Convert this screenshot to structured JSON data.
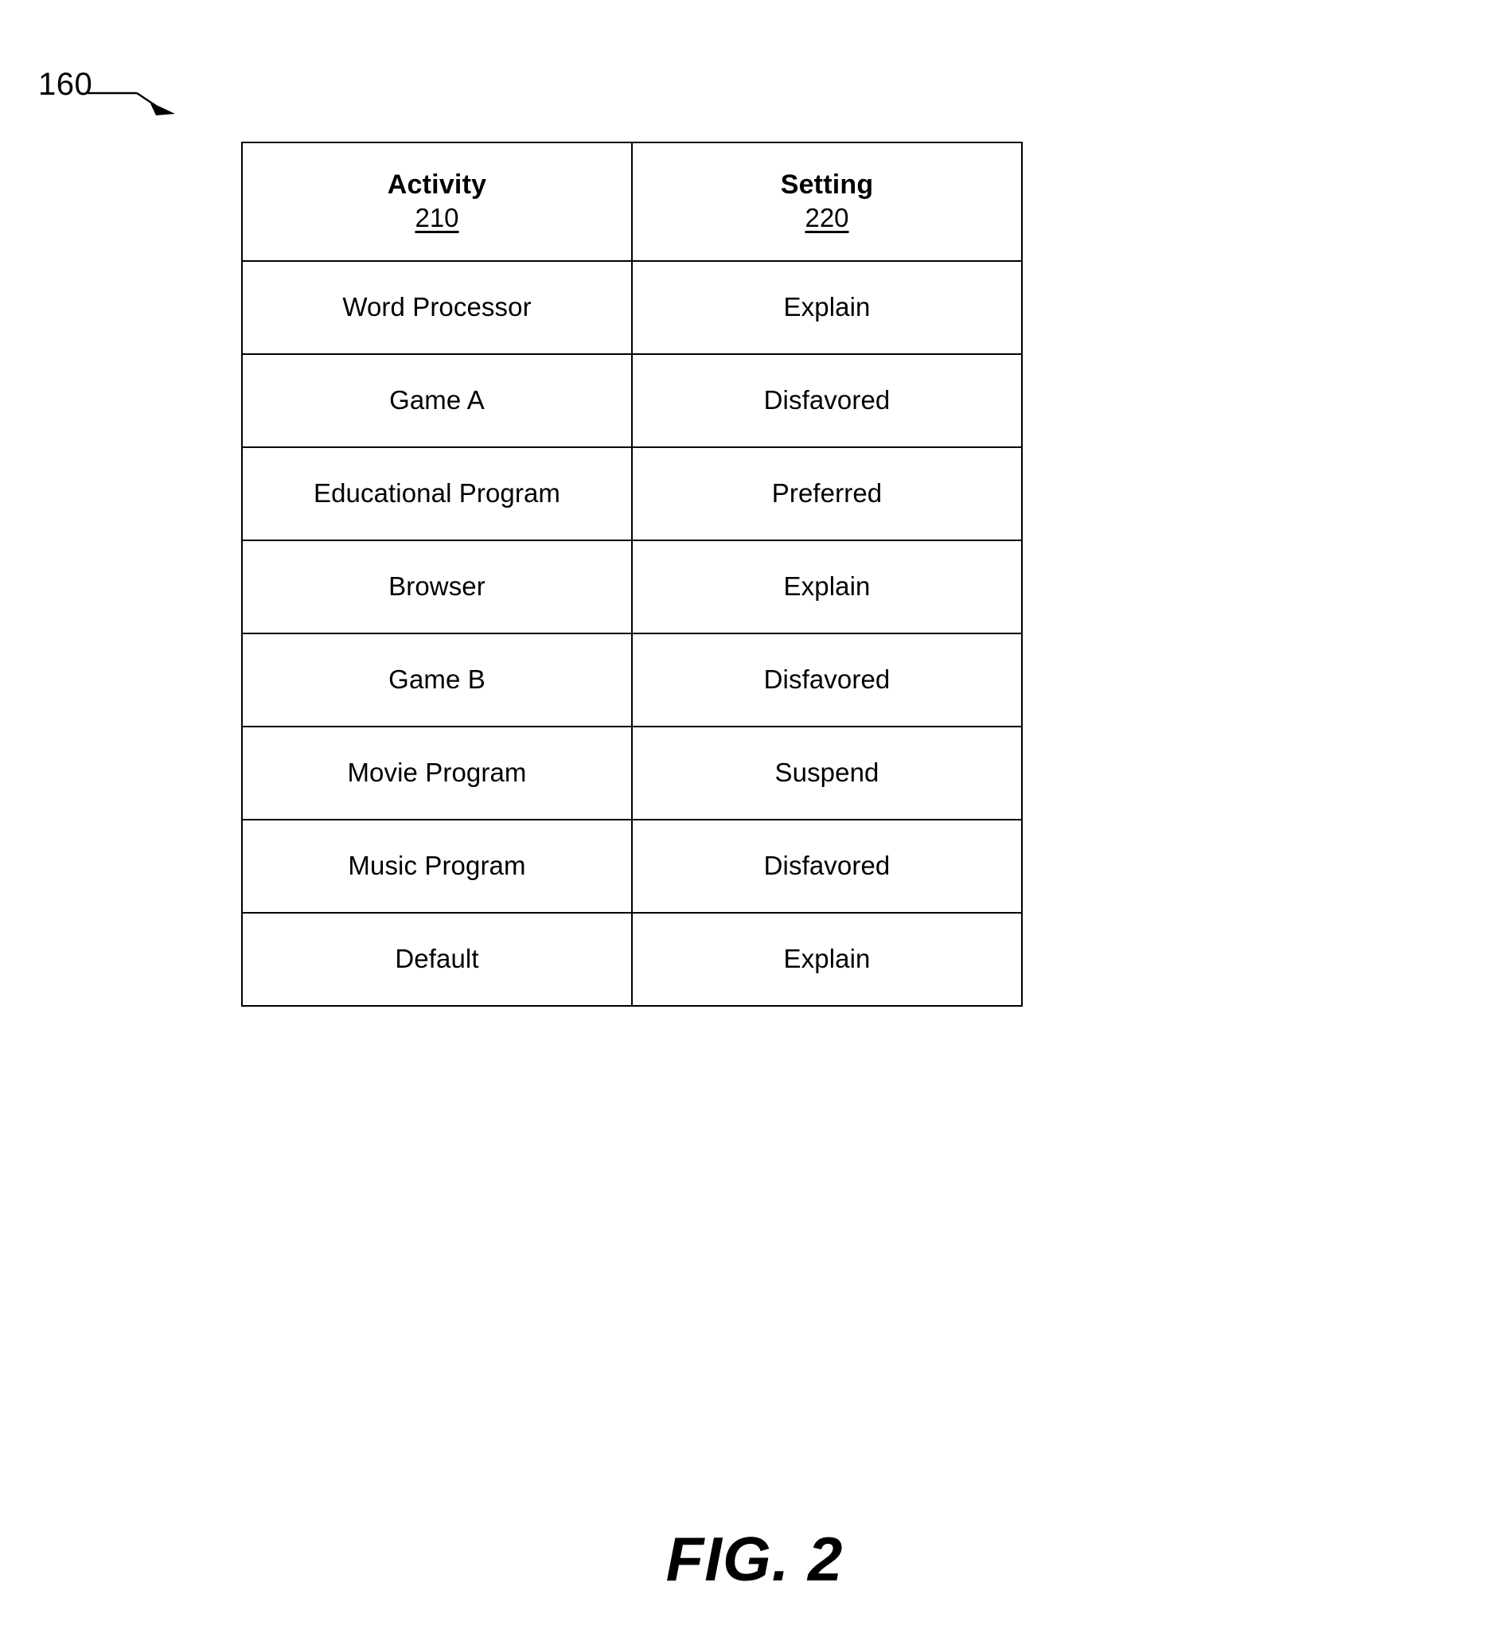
{
  "figure": {
    "reference_label": "160",
    "caption": "FIG. 2"
  },
  "table": {
    "columns": [
      {
        "title": "Activity",
        "ref": "210"
      },
      {
        "title": "Setting",
        "ref": "220"
      }
    ],
    "rows": [
      {
        "activity": "Word Processor",
        "setting": "Explain"
      },
      {
        "activity": "Game A",
        "setting": "Disfavored"
      },
      {
        "activity": "Educational Program",
        "setting": "Preferred"
      },
      {
        "activity": "Browser",
        "setting": "Explain"
      },
      {
        "activity": "Game B",
        "setting": "Disfavored"
      },
      {
        "activity": "Movie Program",
        "setting": "Suspend"
      },
      {
        "activity": "Music Program",
        "setting": "Disfavored"
      },
      {
        "activity": "Default",
        "setting": "Explain"
      }
    ]
  }
}
